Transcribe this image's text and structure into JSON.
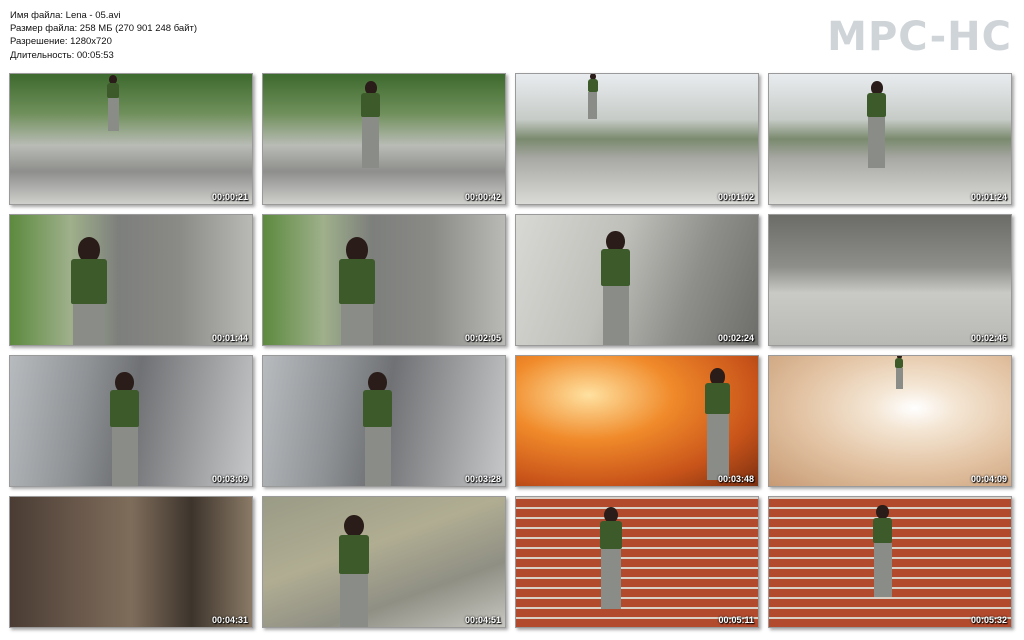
{
  "info": {
    "filename": "Имя файла: Lena - 05.avi",
    "filesize": "Размер файла: 258 МБ (270 901 248 байт)",
    "resolution": "Разрешение: 1280x720",
    "duration": "Длительность: 00:05:53"
  },
  "logo": "MPC-HC",
  "thumbnails": [
    {
      "time": "00:00:21",
      "scene": "street"
    },
    {
      "time": "00:00:42",
      "scene": "street"
    },
    {
      "time": "00:01:02",
      "scene": "street-wide"
    },
    {
      "time": "00:01:24",
      "scene": "street-wide"
    },
    {
      "time": "00:01:44",
      "scene": "legs-wall"
    },
    {
      "time": "00:02:05",
      "scene": "legs-wall"
    },
    {
      "time": "00:02:24",
      "scene": "walking-stairs"
    },
    {
      "time": "00:02:46",
      "scene": "concrete"
    },
    {
      "time": "00:03:09",
      "scene": "ramp"
    },
    {
      "time": "00:03:28",
      "scene": "ramp"
    },
    {
      "time": "00:03:48",
      "scene": "tunnel-orange"
    },
    {
      "time": "00:04:09",
      "scene": "tunnel-pale"
    },
    {
      "time": "00:04:31",
      "scene": "blur"
    },
    {
      "time": "00:04:51",
      "scene": "grass"
    },
    {
      "time": "00:05:11",
      "scene": "brick"
    },
    {
      "time": "00:05:32",
      "scene": "brick"
    }
  ]
}
